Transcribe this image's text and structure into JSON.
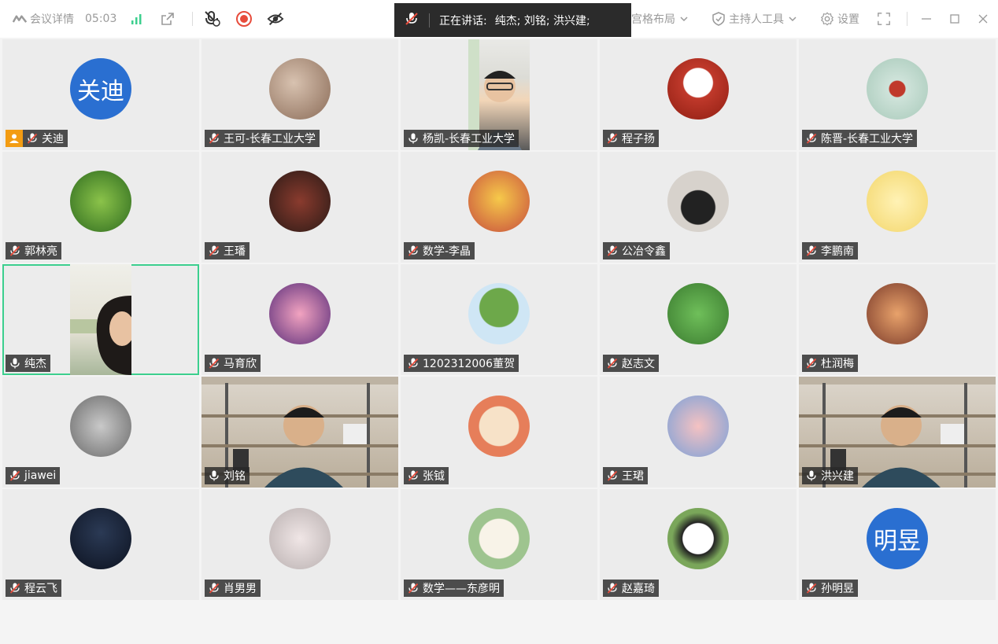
{
  "toolbar": {
    "meeting_details": "会议详情",
    "timer": "05:03",
    "grid_layout": "宫格布局",
    "host_tools": "主持人工具",
    "settings": "设置"
  },
  "speaking": {
    "label": "正在讲话:",
    "names": "纯杰; 刘铭; 洪兴建;"
  },
  "colors": {
    "accent": "#2a6fd1",
    "active_border": "#3ccf8e",
    "host_badge": "#f39c12",
    "muted_red": "#e74c3c"
  },
  "participants": [
    {
      "name": "关迪",
      "avatar_text": "关迪",
      "host": true,
      "mic": "muted"
    },
    {
      "name": "王可-长春工业大学",
      "mic": "muted"
    },
    {
      "name": "杨凯-长春工业大学",
      "mic": "on",
      "video": true
    },
    {
      "name": "程子扬",
      "mic": "muted"
    },
    {
      "name": "陈晋-长春工业大学",
      "mic": "muted"
    },
    {
      "name": "郭林亮",
      "mic": "muted"
    },
    {
      "name": "王璠",
      "mic": "muted"
    },
    {
      "name": "数学-李晶",
      "mic": "muted"
    },
    {
      "name": "公冶令鑫",
      "mic": "muted"
    },
    {
      "name": "李鹏南",
      "mic": "muted"
    },
    {
      "name": "纯杰",
      "mic": "on",
      "video": true,
      "active": true
    },
    {
      "name": "马育欣",
      "mic": "muted"
    },
    {
      "name": "1202312006董贺",
      "mic": "muted"
    },
    {
      "name": "赵志文",
      "mic": "muted"
    },
    {
      "name": "杜润梅",
      "mic": "muted"
    },
    {
      "name": "jiawei",
      "mic": "muted"
    },
    {
      "name": "刘铭",
      "mic": "on",
      "video": true
    },
    {
      "name": "张钺",
      "mic": "muted"
    },
    {
      "name": "王珺",
      "mic": "muted"
    },
    {
      "name": "洪兴建",
      "mic": "on",
      "video": true
    },
    {
      "name": "程云飞",
      "mic": "muted"
    },
    {
      "name": "肖男男",
      "mic": "muted"
    },
    {
      "name": "数学——东彦明",
      "mic": "muted"
    },
    {
      "name": "赵嘉琦",
      "mic": "muted"
    },
    {
      "name": "孙明昱",
      "avatar_text": "明昱",
      "mic": "muted"
    }
  ]
}
